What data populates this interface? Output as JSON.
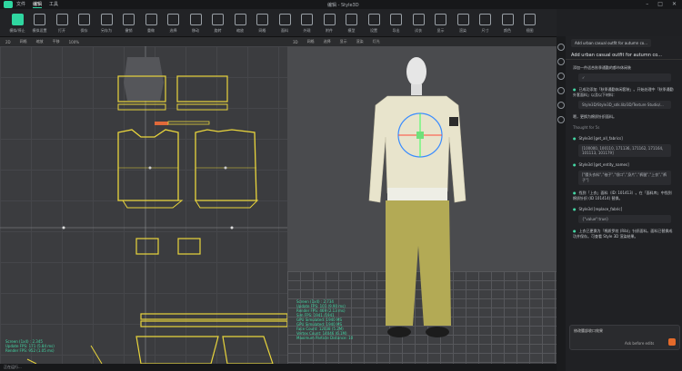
{
  "app": {
    "title": "编辑 - Style3D",
    "menu": [
      "文件",
      "编辑",
      "工具"
    ],
    "active_menu": "编辑"
  },
  "toolbar": {
    "items": [
      "模拟/停止",
      "模拟设置",
      "打开",
      "保存",
      "另存为",
      "撤销",
      "重做",
      "选择",
      "移动",
      "旋转",
      "缩放",
      "网格",
      "面料",
      "外观",
      "附件",
      "模型",
      "设置",
      "导出",
      "试衣",
      "显示",
      "渲染",
      "尺寸",
      "颜色",
      "视图"
    ]
  },
  "pattern_view": {
    "bar": [
      "2D",
      "网格",
      "缩放",
      "平移",
      "100%"
    ],
    "overlay": [
      "Screen (1x4) : 2.345",
      "Update FPS: 171 (5.84 ms)",
      "Render FPS: 952 (1.05 ms)"
    ]
  },
  "avatar_view": {
    "bar": [
      "3D",
      "网格",
      "选择",
      "显示",
      "渲染",
      "灯光"
    ],
    "overlay": [
      "Screen (1x4) : 2.734",
      "Update FPS: 101 (9.90 ms)",
      "Render FPS: 469 (2.13 ms)",
      "Sim FPS: 1941 /1941",
      "GPU Simulated: 1940 MS",
      "GPU Simulated: 1940 MS",
      "Face Count: 12038 (5.2M)",
      "Vertex Count: 14046 (6.1M)",
      "Maximum Particle Distance: 10"
    ]
  },
  "status": {
    "text": "正在运行..."
  },
  "chat": {
    "tab": "Add urban casual outfit for autumn co...",
    "title": "Add urban casual outfit for autumn co...",
    "user_msg": "添加一件适合秋季通勤的都市休闲装",
    "code1": "✓",
    "msg1": "已成功添加「秋季通勤休闲套装」。开始处理中「秋季通勤外套面料」以及以下材料：",
    "link": "Style3D/Style3D_sdk.lib/3D/Texture Studio/...",
    "msg2": "嗯，更换为棉质针织面料。",
    "thought": "Thought for 5s",
    "tool1": "Style3d [get_all_fabrics]",
    "code2": "[100000, 100110, 171136, 171162, 171164, 101113, 101179]",
    "tool2": "Style3d [get_entity_names]",
    "code3": "[\"腰头衣料\",\"袖子\",\"领口\",\"身片\",\"裤腿\",\"上衣\",\"裤子\"]",
    "msg3": "找到「上衣」面料（ID: 101413）。在「面料库」中找到棉质针织 (ID 101414) 替换。",
    "tool3": "Style3d [replace_fabric]",
    "code4": "{\"value\":true}",
    "msg4": "上衣已更换为「棉质罗纹 (Rib)」针织面料。面料已替换成功并保存。可查看 Style 3D 渲染结果。",
    "input": "修改腰部收口效果",
    "agent": "Ask before edits"
  }
}
